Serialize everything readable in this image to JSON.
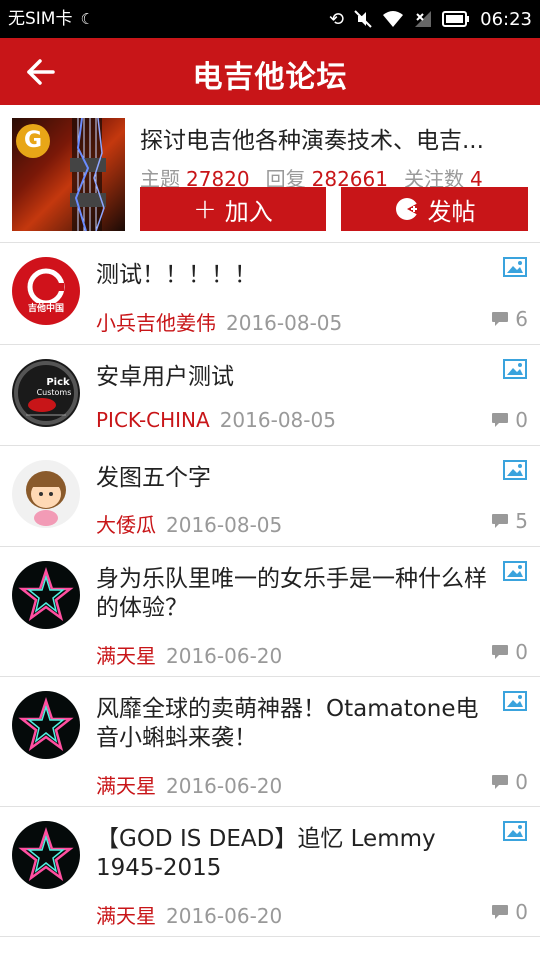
{
  "statusbar": {
    "carrier": "无SIM卡",
    "time": "06:23"
  },
  "header": {
    "title": "电吉他论坛"
  },
  "forum": {
    "description": "探讨电吉他各种演奏技术、电吉...",
    "topics_label": "主题",
    "topics": "27820",
    "replies_label": "回复",
    "replies": "282661",
    "followers_label": "关注数",
    "followers": "4",
    "join_label": "加入",
    "post_label": "发帖"
  },
  "posts": [
    {
      "title": "测试！！！！！",
      "author": "小兵吉他姜伟",
      "date": "2016-08-05",
      "comments": "6",
      "avatar": "jita-logo"
    },
    {
      "title": "安卓用户测试",
      "author": "PICK-CHINA",
      "date": "2016-08-05",
      "comments": "0",
      "avatar": "pick-customs"
    },
    {
      "title": "发图五个字",
      "author": "大倭瓜",
      "date": "2016-08-05",
      "comments": "5",
      "avatar": "cartoon-girl"
    },
    {
      "title": "身为乐队里唯一的女乐手是一种什么样的体验？",
      "author": "满天星",
      "date": "2016-06-20",
      "comments": "0",
      "avatar": "neon-star"
    },
    {
      "title": "风靡全球的卖萌神器！Otamatone电音小蝌蚪来袭！",
      "author": "满天星",
      "date": "2016-06-20",
      "comments": "0",
      "avatar": "neon-star"
    },
    {
      "title": "【GOD IS DEAD】追忆 Lemmy 1945-2015",
      "author": "满天星",
      "date": "2016-06-20",
      "comments": "0",
      "avatar": "neon-star"
    }
  ],
  "colors": {
    "accent": "#c81518",
    "icon_blue": "#3aa3dd",
    "meta_gray": "#999999"
  }
}
